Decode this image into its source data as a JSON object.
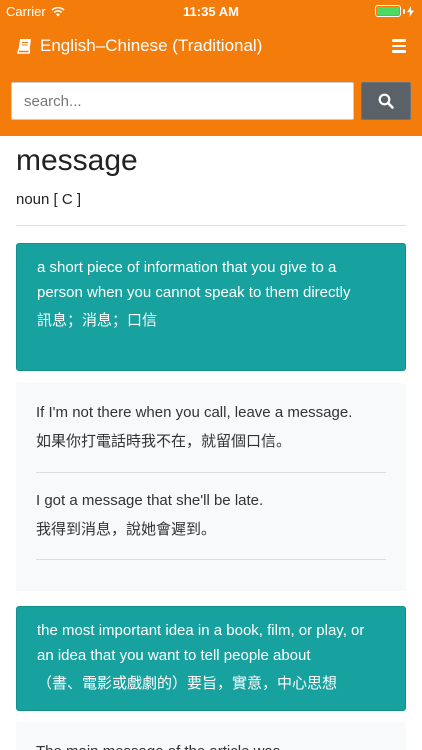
{
  "status_bar": {
    "carrier": "Carrier",
    "time": "11:35 AM"
  },
  "navbar": {
    "title": "English–Chinese (Traditional)"
  },
  "search": {
    "placeholder": "search..."
  },
  "entry": {
    "headword": "message",
    "pos": "noun [ C ]",
    "senses": [
      {
        "definition": "a short piece of information that you give to a person when you cannot speak to them directly",
        "translation": "訊息；消息；口信",
        "examples": [
          {
            "en": "If I'm not there when you call, leave a message.",
            "zh": "如果你打電話時我不在，就留個口信。"
          },
          {
            "en": "I got a message that she'll be late.",
            "zh": "我得到消息，說她會遲到。"
          }
        ]
      },
      {
        "definition": "the most important idea in a book, film, or play, or an idea that you want to tell people about",
        "translation": "（書、電影或戲劇的）要旨，實意，中心思想",
        "examples": [
          {
            "en": "The main message of the article was...",
            "zh": ""
          }
        ]
      }
    ]
  }
}
